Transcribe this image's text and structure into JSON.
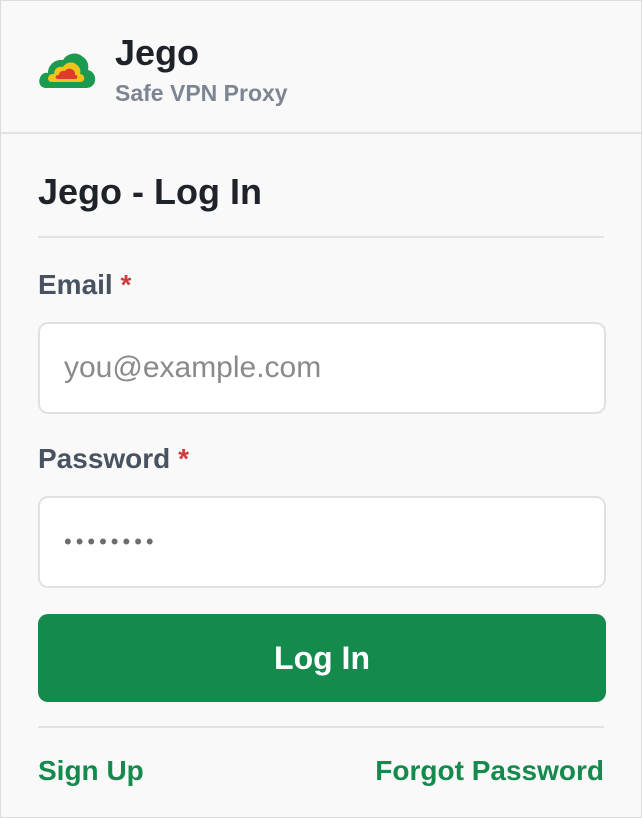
{
  "header": {
    "app_name": "Jego",
    "subtitle": "Safe VPN Proxy",
    "logo_icon": "cloud-logo-icon"
  },
  "form": {
    "title": "Jego - Log In",
    "email_label": "Email",
    "required_marker": "*",
    "email_placeholder": "you@example.com",
    "email_value": "",
    "password_label": "Password",
    "password_value": "••••••••",
    "login_button": "Log In"
  },
  "links": {
    "sign_up": "Sign Up",
    "forgot_password": "Forgot Password"
  },
  "colors": {
    "accent": "#148a4c",
    "required": "#d03a3a",
    "logo_outer": "#1c9a4f",
    "logo_middle": "#f0c419",
    "logo_inner": "#e03a2e"
  }
}
